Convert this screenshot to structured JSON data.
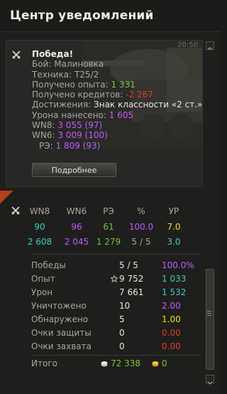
{
  "header": {
    "title": "Центр уведомлений"
  },
  "notification": {
    "time": "20:50",
    "title": "Победа!",
    "battle_label": "Бой:",
    "battle_value": "Малиновка",
    "vehicle_label": "Техника:",
    "vehicle_value": "T25/2",
    "xp_label": "Получено опыта:",
    "xp_value": "1 331",
    "credits_label": "Получено кредитов:",
    "credits_value": "-2 267",
    "achievements_label": "Достижения:",
    "achievements_value": "Знак классности «2 ст.»",
    "damage_label": "Урона нанесено:",
    "damage_value": "1 605",
    "wn8_label": "WN8:",
    "wn8_value": "3 055 (97)",
    "wn6_label": "WN6:",
    "wn6_value": "3 009 (100)",
    "re_label": "РЭ:",
    "re_value": "1 809 (93)",
    "details_button": "Подробнее"
  },
  "stats_table": {
    "headers": [
      "WN8",
      "WN6",
      "РЭ",
      "%",
      "УР"
    ],
    "row1": [
      "90",
      "96",
      "61",
      "100.0",
      "7.0"
    ],
    "row2": [
      "2 608",
      "2 045",
      "1 279",
      "5 / 5",
      "3.0"
    ]
  },
  "summary": {
    "rows": [
      {
        "label": "Победы",
        "a": "5 / 5",
        "b": "100.0%"
      },
      {
        "label": "Опыт",
        "a": "9 752",
        "b": "1 033"
      },
      {
        "label": "Урон",
        "a": "7 661",
        "b": "1 532"
      },
      {
        "label": "Уничтожено",
        "a": "10",
        "b": "2.00"
      },
      {
        "label": "Обнаружено",
        "a": "5",
        "b": "1.00"
      },
      {
        "label": "Очки защиты",
        "a": "0",
        "b": "0.00"
      },
      {
        "label": "Очки захвата",
        "a": "0",
        "b": "0.00"
      }
    ],
    "total_label": "Итого",
    "total_credits": "72 338",
    "total_gold": "0"
  },
  "colors": {
    "green": "#78c83c",
    "red": "#e03a2a",
    "purple": "#c15bff",
    "teal": "#3fcfc3",
    "yellow": "#f1e01c"
  }
}
